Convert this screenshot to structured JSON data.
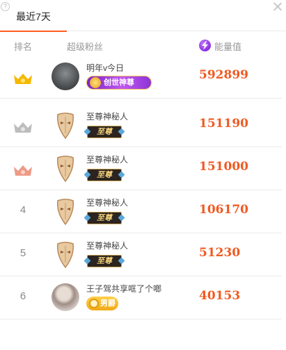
{
  "tabs": [
    {
      "label": "最近7天"
    }
  ],
  "header": {
    "rank": "排名",
    "fan": "超级粉丝",
    "energy": "能量值"
  },
  "rows": [
    {
      "rank": "",
      "name": "明年v今日",
      "badge": "创世神尊",
      "energy": "592899"
    },
    {
      "rank": "",
      "name": "至尊神秘人",
      "badge": "至尊",
      "energy": "151190"
    },
    {
      "rank": "",
      "name": "至尊神秘人",
      "badge": "至尊",
      "energy": "151000"
    },
    {
      "rank": "4",
      "name": "至尊神秘人",
      "badge": "至尊",
      "energy": "106170"
    },
    {
      "rank": "5",
      "name": "至尊神秘人",
      "badge": "至尊",
      "energy": "51230"
    },
    {
      "rank": "6",
      "name": "王子驾共享哐了个啷",
      "badge": "男爵",
      "energy": "40153"
    }
  ],
  "colors": {
    "accent": "#ff5d22",
    "energy_text": "#f05a22",
    "gold_crown": "#f5b800",
    "silver_crown": "#bdbdbd",
    "bronze_crown": "#ee9a87"
  },
  "icons": {
    "help": "question-icon",
    "close": "close-icon",
    "energy": "lightning-icon"
  }
}
